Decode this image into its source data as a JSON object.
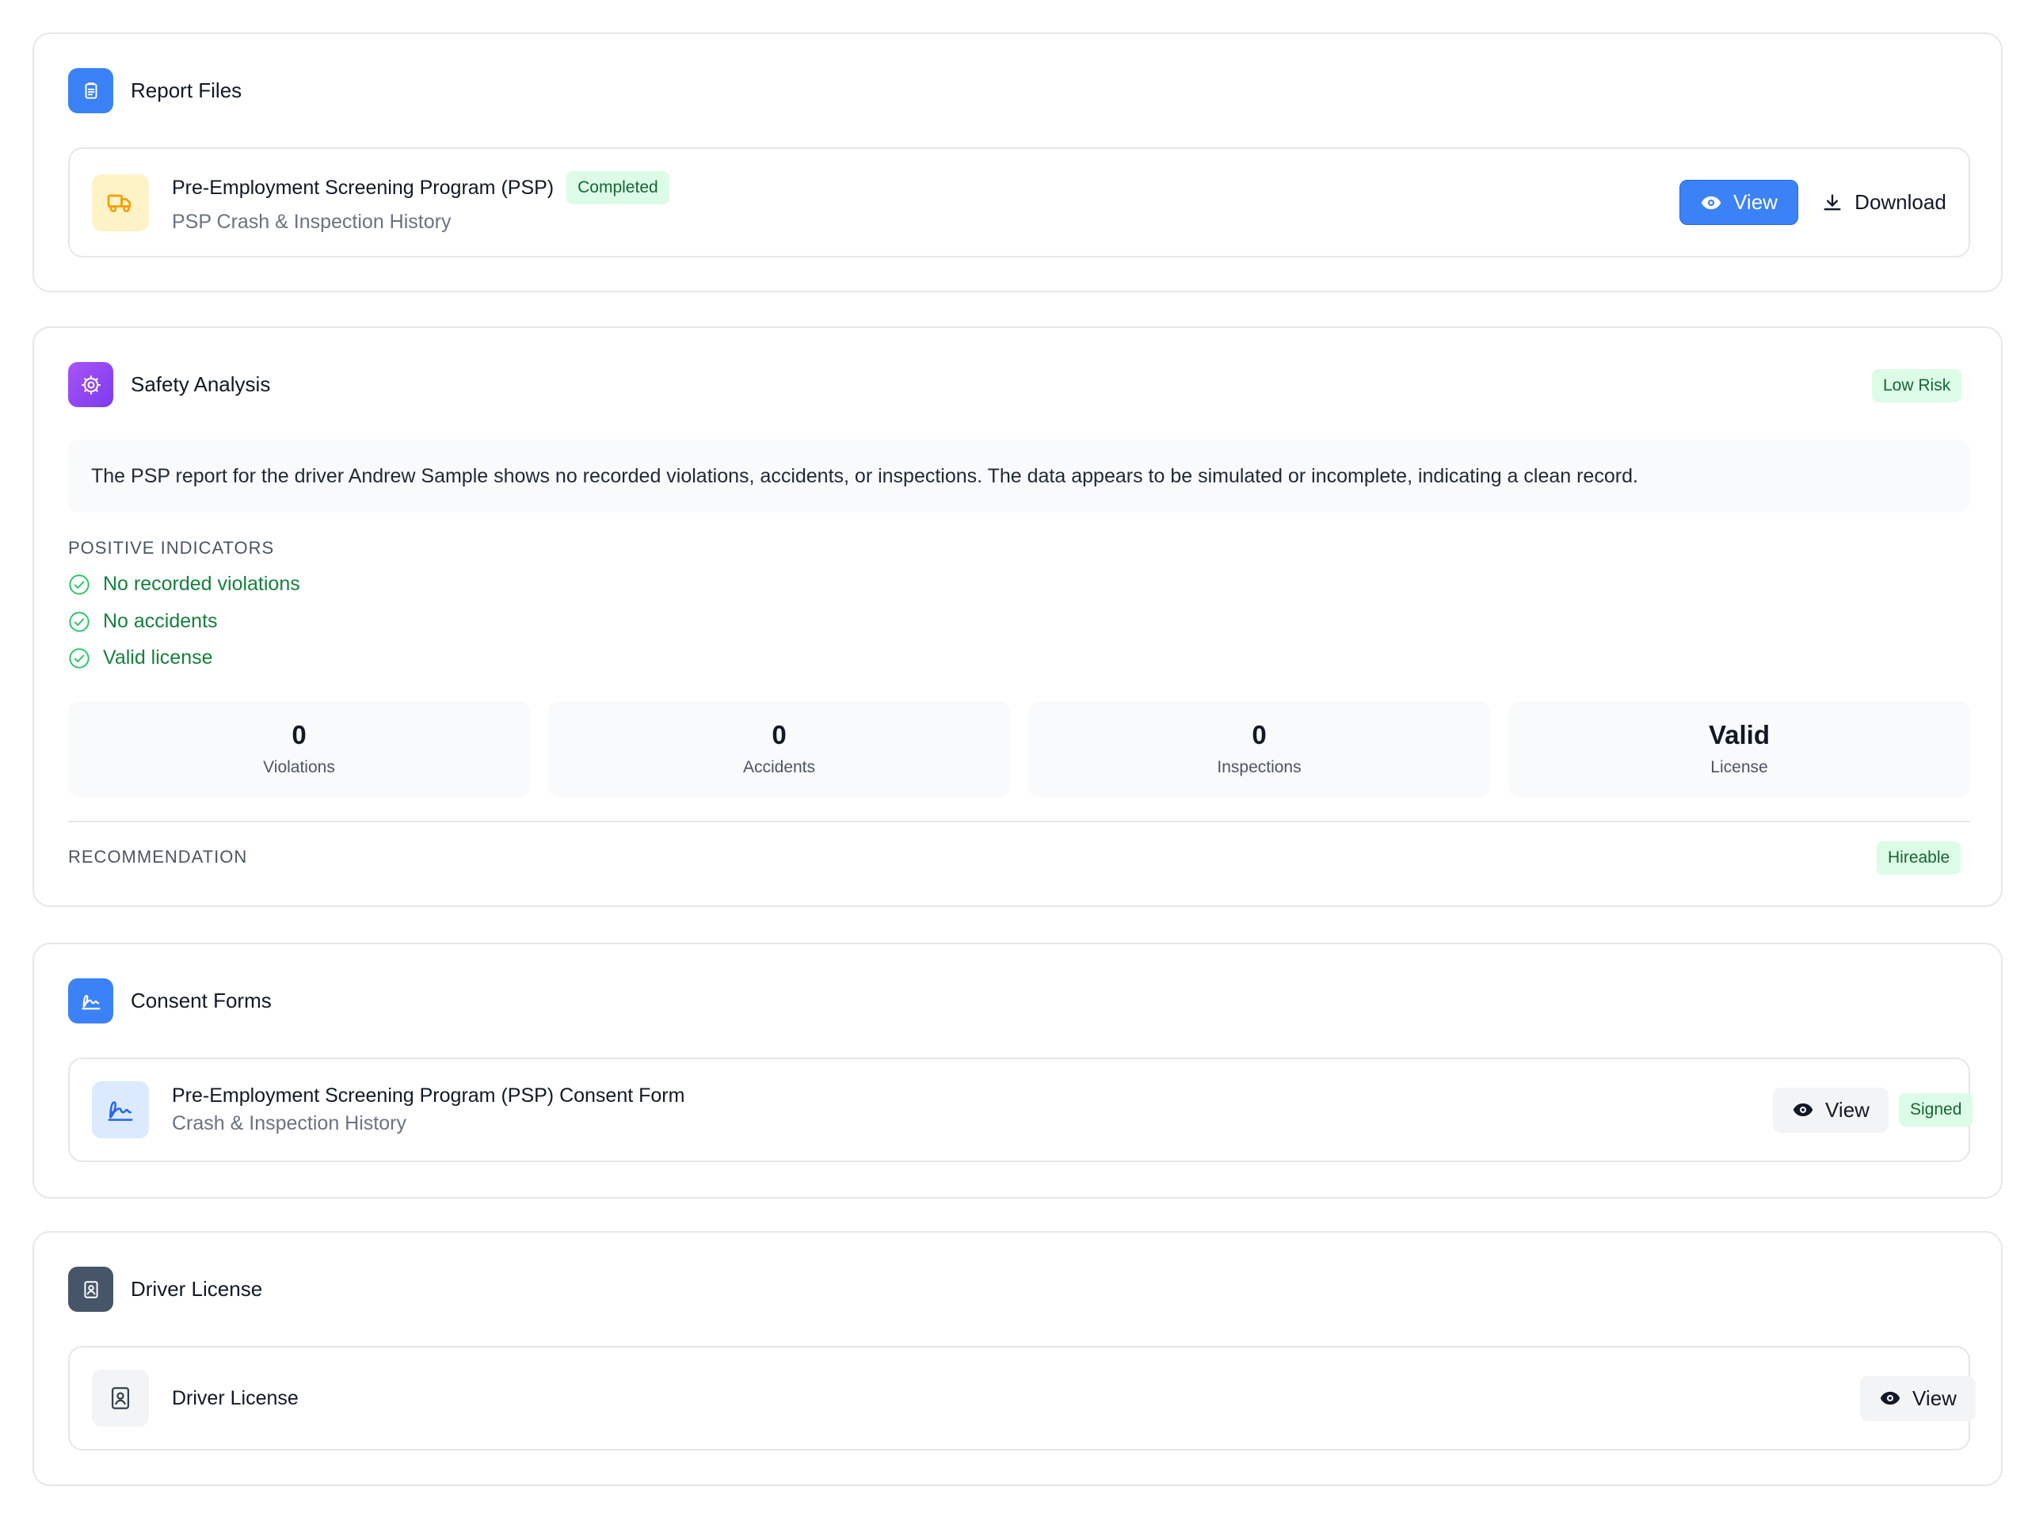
{
  "report_files": {
    "title": "Report Files",
    "icon": "document-icon",
    "file": {
      "icon": "truck-icon",
      "title": "Pre-Employment Screening Program (PSP)",
      "status": "Completed",
      "subtitle": "PSP Crash & Inspection History",
      "view_label": "View",
      "download_label": "Download"
    }
  },
  "safety_analysis": {
    "title": "Safety Analysis",
    "icon": "cog-icon",
    "risk_badge": "Low Risk",
    "summary": "The PSP report for the driver Andrew Sample shows no recorded violations, accidents, or inspections. The data appears to be simulated or incomplete, indicating a clean record.",
    "positive_indicators_label": "POSITIVE INDICATORS",
    "indicators": [
      "No recorded violations",
      "No accidents",
      "Valid license"
    ],
    "stats": [
      {
        "value": "0",
        "label": "Violations"
      },
      {
        "value": "0",
        "label": "Accidents"
      },
      {
        "value": "0",
        "label": "Inspections"
      },
      {
        "value": "Valid",
        "label": "License"
      }
    ],
    "recommendation_label": "RECOMMENDATION",
    "recommendation_badge": "Hireable"
  },
  "consent_forms": {
    "title": "Consent Forms",
    "icon": "signature-icon",
    "form": {
      "icon": "signature-icon",
      "title": "Pre-Employment Screening Program (PSP) Consent Form",
      "subtitle": "Crash & Inspection History",
      "view_label": "View",
      "status": "Signed"
    }
  },
  "driver_license": {
    "title": "Driver License",
    "icon": "id-badge-icon",
    "file": {
      "icon": "id-badge-icon",
      "title": "Driver License",
      "view_label": "View"
    }
  },
  "colors": {
    "primary": "#3b82f6",
    "purple": "#8b5cf6",
    "slate": "#475569",
    "success_bg": "#dcfce7",
    "success_text": "#166534"
  }
}
